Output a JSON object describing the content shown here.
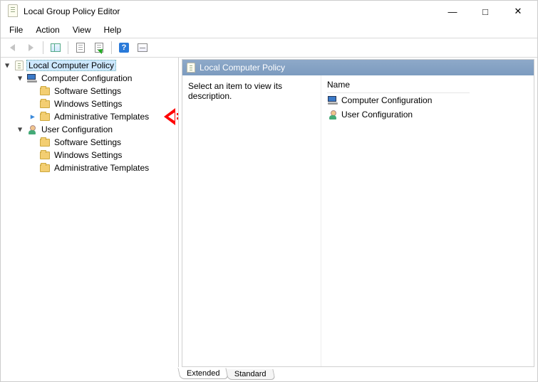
{
  "window": {
    "title": "Local Group Policy Editor"
  },
  "menu": {
    "file": "File",
    "action": "Action",
    "view": "View",
    "help": "Help"
  },
  "tree": {
    "root": "Local Computer Policy",
    "computer": "Computer Configuration",
    "user": "User Configuration",
    "software": "Software Settings",
    "windows": "Windows Settings",
    "admin": "Administrative Templates"
  },
  "content": {
    "heading": "Local Computer Policy",
    "description": "Select an item to view its description.",
    "name_header": "Name",
    "item_computer": "Computer Configuration",
    "item_user": "User Configuration"
  },
  "tabs": {
    "extended": "Extended",
    "standard": "Standard"
  }
}
